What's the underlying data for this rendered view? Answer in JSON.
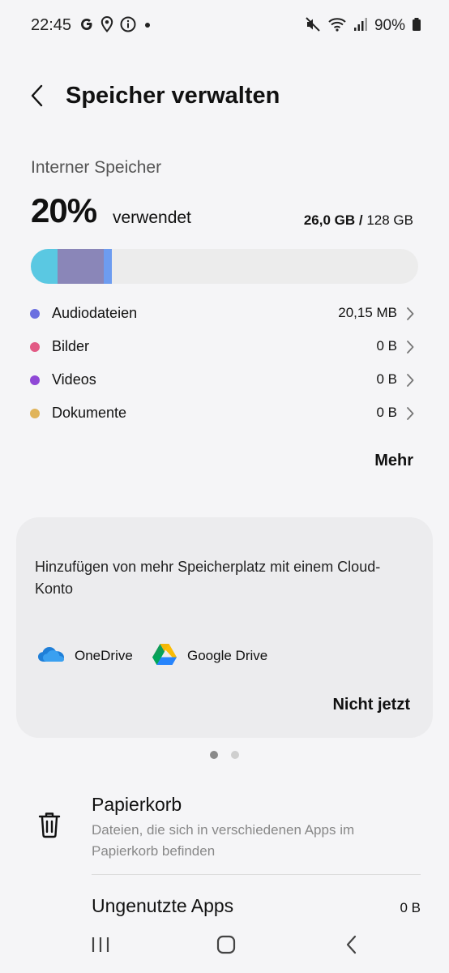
{
  "status_bar": {
    "time": "22:45",
    "left_icons": [
      "google-icon",
      "location-pin-icon",
      "info-icon",
      "dot-icon"
    ],
    "right_icons": [
      "mute-icon",
      "wifi-icon",
      "signal-icon",
      "battery-icon"
    ],
    "battery_text": "90%"
  },
  "header": {
    "back_icon": "chevron-left-icon",
    "title": "Speicher verwalten"
  },
  "storage": {
    "section_label": "Interner Speicher",
    "percent": "20%",
    "percent_suffix": "verwendet",
    "used": "26,0 GB /",
    "total": "128 GB",
    "bar_fill": {
      "segments": [
        {
          "name": "cyan",
          "color": "#5ac8e2",
          "fraction": 0.07
        },
        {
          "name": "purple",
          "color": "#8a86b8",
          "fraction": 0.12
        },
        {
          "name": "blue",
          "color": "#6d9cf0",
          "fraction": 0.02
        }
      ]
    },
    "categories": [
      {
        "label": "Audiodateien",
        "value": "20,15 MB",
        "color": "#6b6fe0"
      },
      {
        "label": "Bilder",
        "value": "0 B",
        "color": "#e25a85"
      },
      {
        "label": "Videos",
        "value": "0 B",
        "color": "#8f48d6"
      },
      {
        "label": "Dokumente",
        "value": "0 B",
        "color": "#e0b45a"
      }
    ],
    "more_label": "Mehr"
  },
  "cloud_card": {
    "text": "Hinzufügen von mehr Speicherplatz mit einem Cloud-Konto",
    "options": [
      {
        "label": "OneDrive",
        "icon": "onedrive-icon"
      },
      {
        "label": "Google Drive",
        "icon": "google-drive-icon"
      }
    ],
    "dismiss_label": "Nicht jetzt"
  },
  "pager": {
    "count": 2,
    "active": 0,
    "active_color": "#8a8a8a",
    "inactive_color": "#cfcfcf"
  },
  "trash": {
    "icon": "trash-icon",
    "title": "Papierkorb",
    "description": "Dateien, die sich in verschiedenen Apps im Papierkorb befinden"
  },
  "unused_apps": {
    "title": "Ungenutzte Apps",
    "value": "0 B"
  },
  "nav_bar": {
    "buttons": [
      "recent-apps-icon",
      "home-icon",
      "back-icon"
    ]
  }
}
